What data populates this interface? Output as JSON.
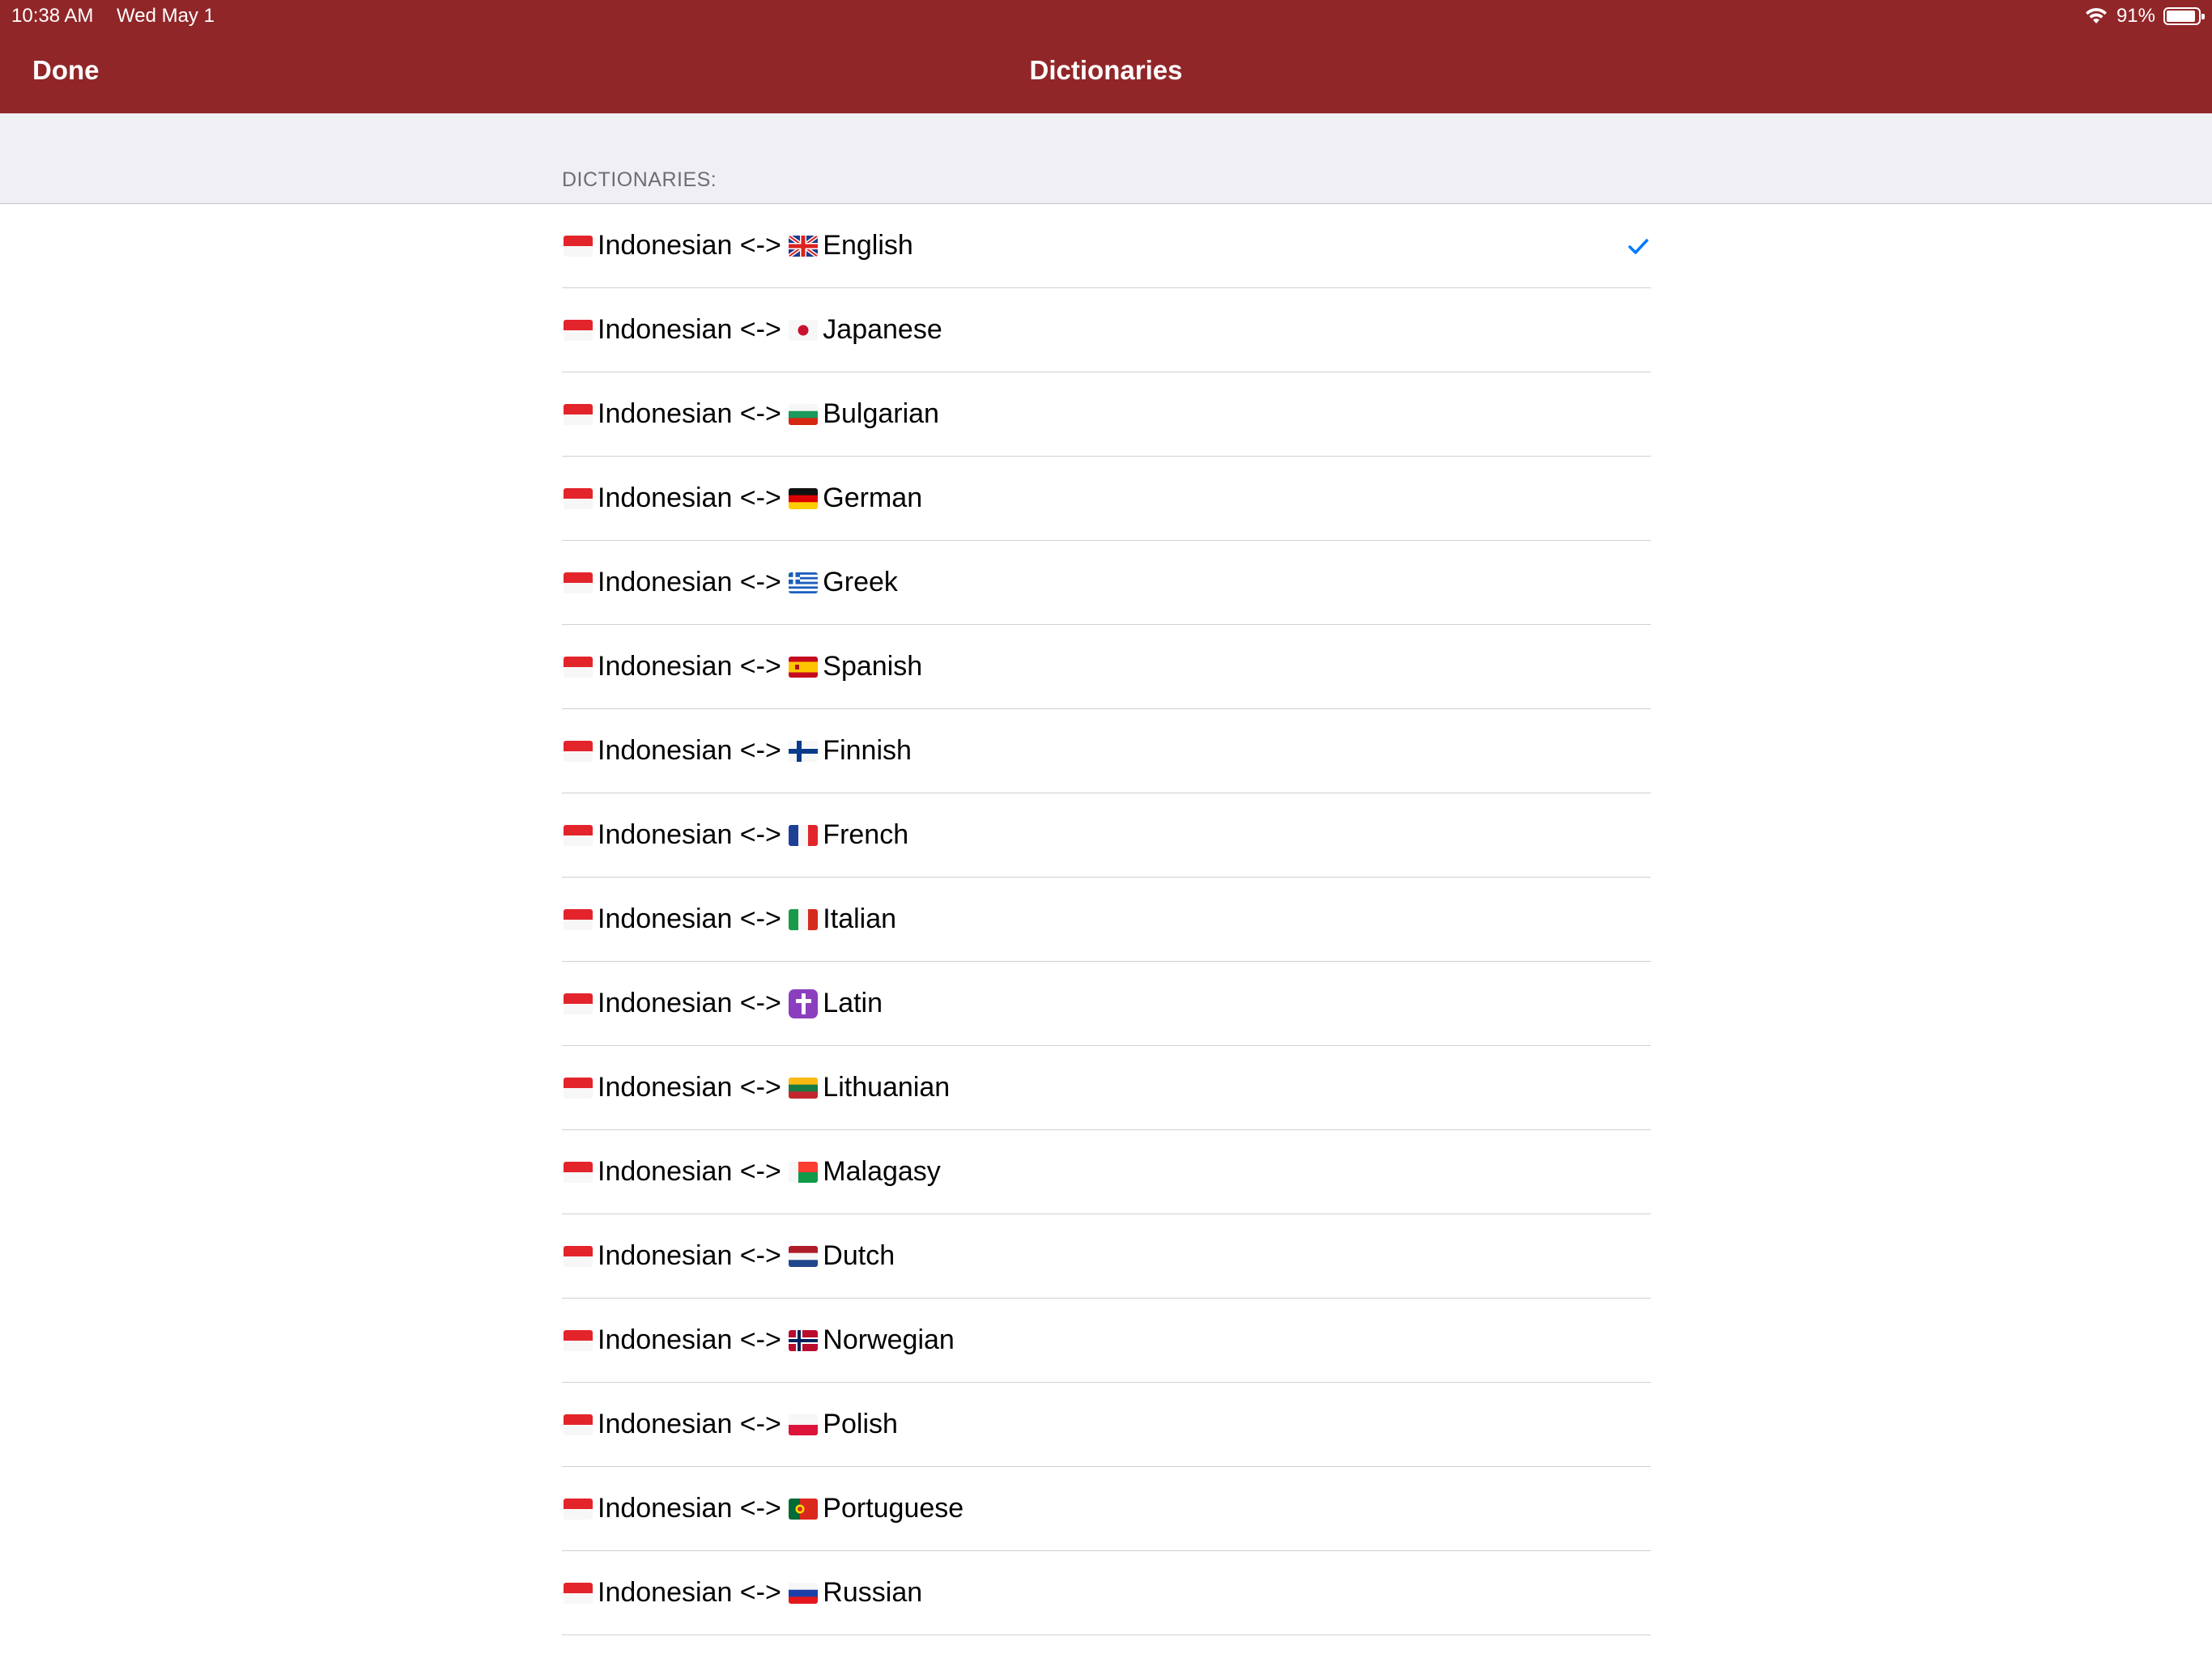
{
  "status_bar": {
    "time": "10:38 AM",
    "date": "Wed May 1",
    "battery_text": "91%",
    "battery_level": 0.91,
    "icons": [
      "wifi-icon",
      "battery-icon"
    ]
  },
  "nav": {
    "done_label": "Done",
    "title": "Dictionaries",
    "bar_color": "#912628"
  },
  "section": {
    "header": "DICTIONARIES:"
  },
  "accent_color": "#007aff",
  "dictionaries": [
    {
      "label": "Indonesian <-> ",
      "target": "English",
      "flag": "gb",
      "selected": true
    },
    {
      "label": "Indonesian <-> ",
      "target": "Japanese",
      "flag": "jp",
      "selected": false
    },
    {
      "label": "Indonesian <-> ",
      "target": "Bulgarian",
      "flag": "bg",
      "selected": false
    },
    {
      "label": "Indonesian <-> ",
      "target": "German",
      "flag": "de",
      "selected": false
    },
    {
      "label": "Indonesian <-> ",
      "target": "Greek",
      "flag": "gr",
      "selected": false
    },
    {
      "label": "Indonesian <-> ",
      "target": "Spanish",
      "flag": "es",
      "selected": false
    },
    {
      "label": "Indonesian <-> ",
      "target": "Finnish",
      "flag": "fi",
      "selected": false
    },
    {
      "label": "Indonesian <-> ",
      "target": "French",
      "flag": "fr",
      "selected": false
    },
    {
      "label": "Indonesian <-> ",
      "target": "Italian",
      "flag": "it",
      "selected": false
    },
    {
      "label": "Indonesian <-> ",
      "target": "Latin",
      "flag": "latin-cross",
      "selected": false
    },
    {
      "label": "Indonesian <-> ",
      "target": "Lithuanian",
      "flag": "lt",
      "selected": false
    },
    {
      "label": "Indonesian <-> ",
      "target": "Malagasy",
      "flag": "mg",
      "selected": false
    },
    {
      "label": "Indonesian <-> ",
      "target": "Dutch",
      "flag": "nl",
      "selected": false
    },
    {
      "label": "Indonesian <-> ",
      "target": "Norwegian",
      "flag": "no",
      "selected": false
    },
    {
      "label": "Indonesian <-> ",
      "target": "Polish",
      "flag": "pl",
      "selected": false
    },
    {
      "label": "Indonesian <-> ",
      "target": "Portuguese",
      "flag": "pt",
      "selected": false
    },
    {
      "label": "Indonesian <-> ",
      "target": "Russian",
      "flag": "ru",
      "selected": false
    }
  ]
}
